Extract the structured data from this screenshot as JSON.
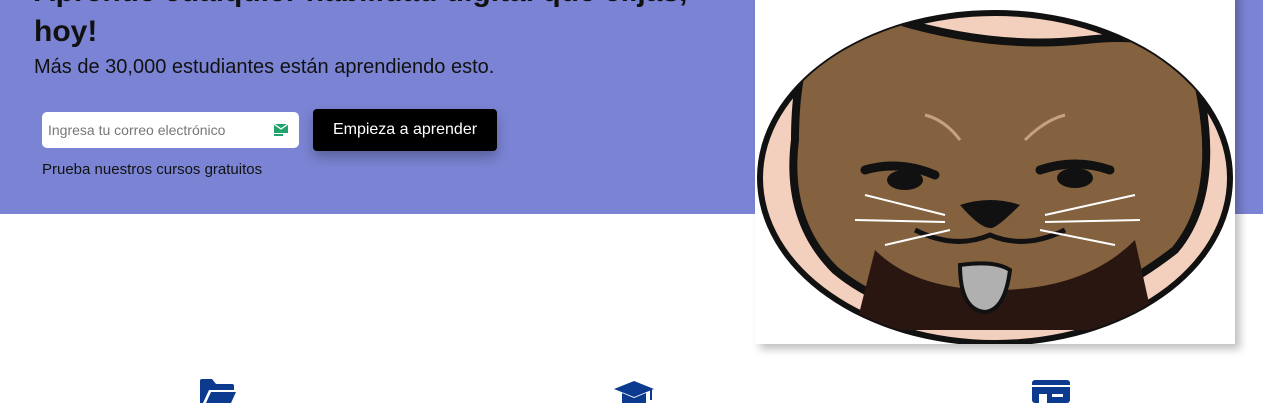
{
  "hero": {
    "title": "Aprende cualquier habilidad digital que elijas, hoy!",
    "subtitle": "Más de 30,000 estudiantes están aprendiendo esto.",
    "email_placeholder": "Ingresa tu correo electrónico",
    "cta_label": "Empieza a aprender",
    "free_courses_link": "Prueba nuestros cursos gratuitos",
    "image": "cat-mascot-illustration"
  },
  "features": {
    "icons": [
      "folder-open-icon",
      "graduation-cap-icon",
      "newspaper-icon"
    ]
  },
  "colors": {
    "hero_background": "#7b84d4",
    "button_background": "#000000",
    "icon_blue": "#0b3a8f"
  }
}
